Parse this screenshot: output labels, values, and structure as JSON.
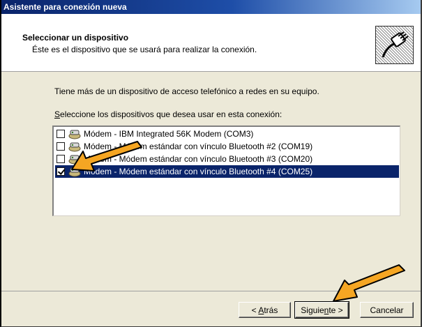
{
  "window": {
    "title": "Asistente para conexión nueva"
  },
  "header": {
    "title": "Seleccionar un dispositivo",
    "subtitle": "Éste es el dispositivo que se usará para realizar la conexión.",
    "icon": "network-cable-icon"
  },
  "body": {
    "intro": "Tiene más de un dispositivo de acceso telefónico a redes en su equipo.",
    "list_label_accel": "S",
    "list_label_rest": "eleccione los dispositivos que desea usar en esta conexión:"
  },
  "devices": [
    {
      "label": "Módem - IBM Integrated 56K Modem (COM3)",
      "checked": false,
      "selected": false
    },
    {
      "label": "Módem - Módem estándar con vínculo Bluetooth #2 (COM19)",
      "checked": false,
      "selected": false
    },
    {
      "label": "Módem - Módem estándar con vínculo Bluetooth #3 (COM20)",
      "checked": false,
      "selected": false
    },
    {
      "label": "Módem - Módem estándar con vínculo Bluetooth #4 (COM25)",
      "checked": true,
      "selected": true
    }
  ],
  "buttons": {
    "back_pre": "< ",
    "back_accel": "A",
    "back_post": "trás",
    "next_pre": "Siguie",
    "next_accel": "n",
    "next_post": "te >",
    "cancel": "Cancelar"
  },
  "colors": {
    "selection": "#0a246a",
    "annotation_arrow": "#f5a623"
  }
}
